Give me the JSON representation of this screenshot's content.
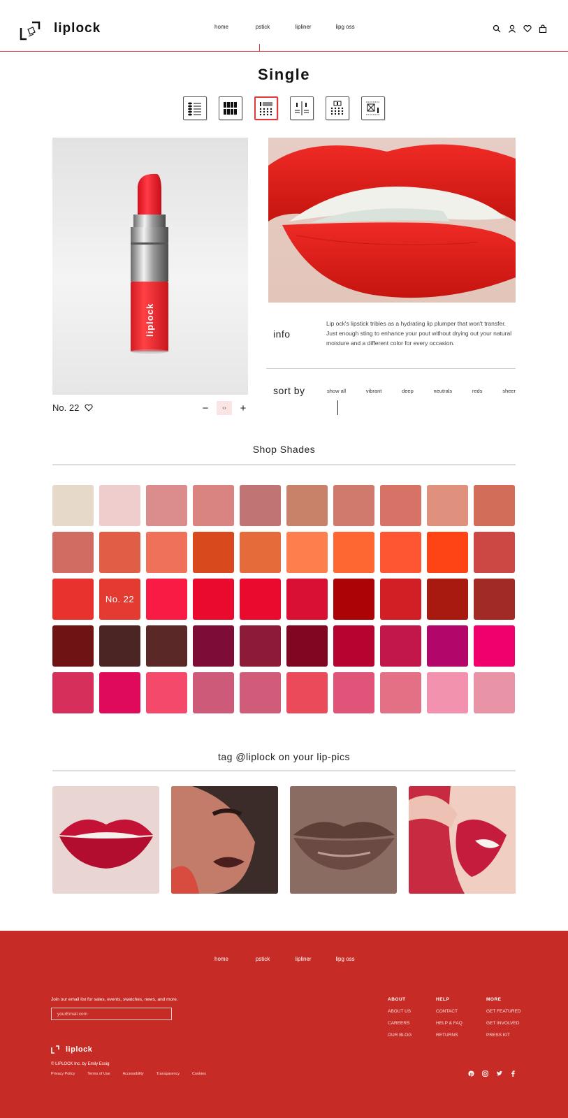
{
  "header": {
    "brand": "liplock",
    "nav": [
      "home",
      "pstick",
      "lipliner",
      "lipg oss"
    ]
  },
  "page": {
    "title": "Single"
  },
  "product": {
    "lipstick_label": "liplock",
    "name": "No. 22",
    "qty_minus": "−",
    "qty_value": "‹›",
    "qty_plus": "+",
    "info_label": "info",
    "info_text": "Lip ock's lipstick tribles as a hydrating lip plumper that won't transfer. Just enough sting to enhance your pout without drying out your natural moisture and a different color for every occasion.",
    "sort_label": "sort by",
    "sort_options": [
      "show all",
      "vibrant",
      "deep",
      "neutrals",
      "reds",
      "sheer"
    ]
  },
  "shades": {
    "title": "Shop Shades",
    "selected_label": "No. 22",
    "colors": [
      "#e7d9ca",
      "#efcdcd",
      "#db8c8d",
      "#d98481",
      "#c07473",
      "#c8826a",
      "#d07a6e",
      "#d67266",
      "#e0917d",
      "#d26d59",
      "#d06c62",
      "#e05d46",
      "#ef7159",
      "#d84a1d",
      "#e66b3b",
      "#fe7f4e",
      "#fe6632",
      "#fe5533",
      "#fe4414",
      "#cc4845",
      "#e8322e",
      "#e33a31",
      "#fa1b45",
      "#e90a2d",
      "#e90a2d",
      "#da0f34",
      "#ac0307",
      "#d21f25",
      "#a81910",
      "#a22a25",
      "#6f1315",
      "#4b2524",
      "#5a2826",
      "#7d0d36",
      "#8d1a36",
      "#7f0722",
      "#b60431",
      "#c1174b",
      "#b3066a",
      "#ef006c",
      "#d62f5c",
      "#e00a5a",
      "#f4496a",
      "#ce5a79",
      "#d15c79",
      "#eb4a5b",
      "#e0547a",
      "#e37084",
      "#f292ae",
      "#e893a6"
    ]
  },
  "gallery": {
    "title": "tag @liplock on your lip-pics"
  },
  "footer": {
    "nav": [
      "home",
      "pstick",
      "lipliner",
      "lipg oss"
    ],
    "join_text": "Join our email list for sales, events, swatches, news, and more.",
    "email_placeholder": "yourEmail.com",
    "cols": [
      {
        "title": "ABOUT",
        "links": [
          "ABOUT US",
          "CAREERS",
          "OUR BLOG"
        ]
      },
      {
        "title": "HELP",
        "links": [
          "CONTACT",
          "HELP & FAQ",
          "RETURNS"
        ]
      },
      {
        "title": "MORE",
        "links": [
          "GET FEATURED",
          "GET INVOLVED",
          "PRESS KIT"
        ]
      }
    ],
    "brand": "liplock",
    "copyright": "© LIPLOCK Inc. by Emily Essig",
    "legal": [
      "Privacy Policy",
      "Terms of Use",
      "Accessibility",
      "Transparency",
      "Cookies"
    ]
  }
}
